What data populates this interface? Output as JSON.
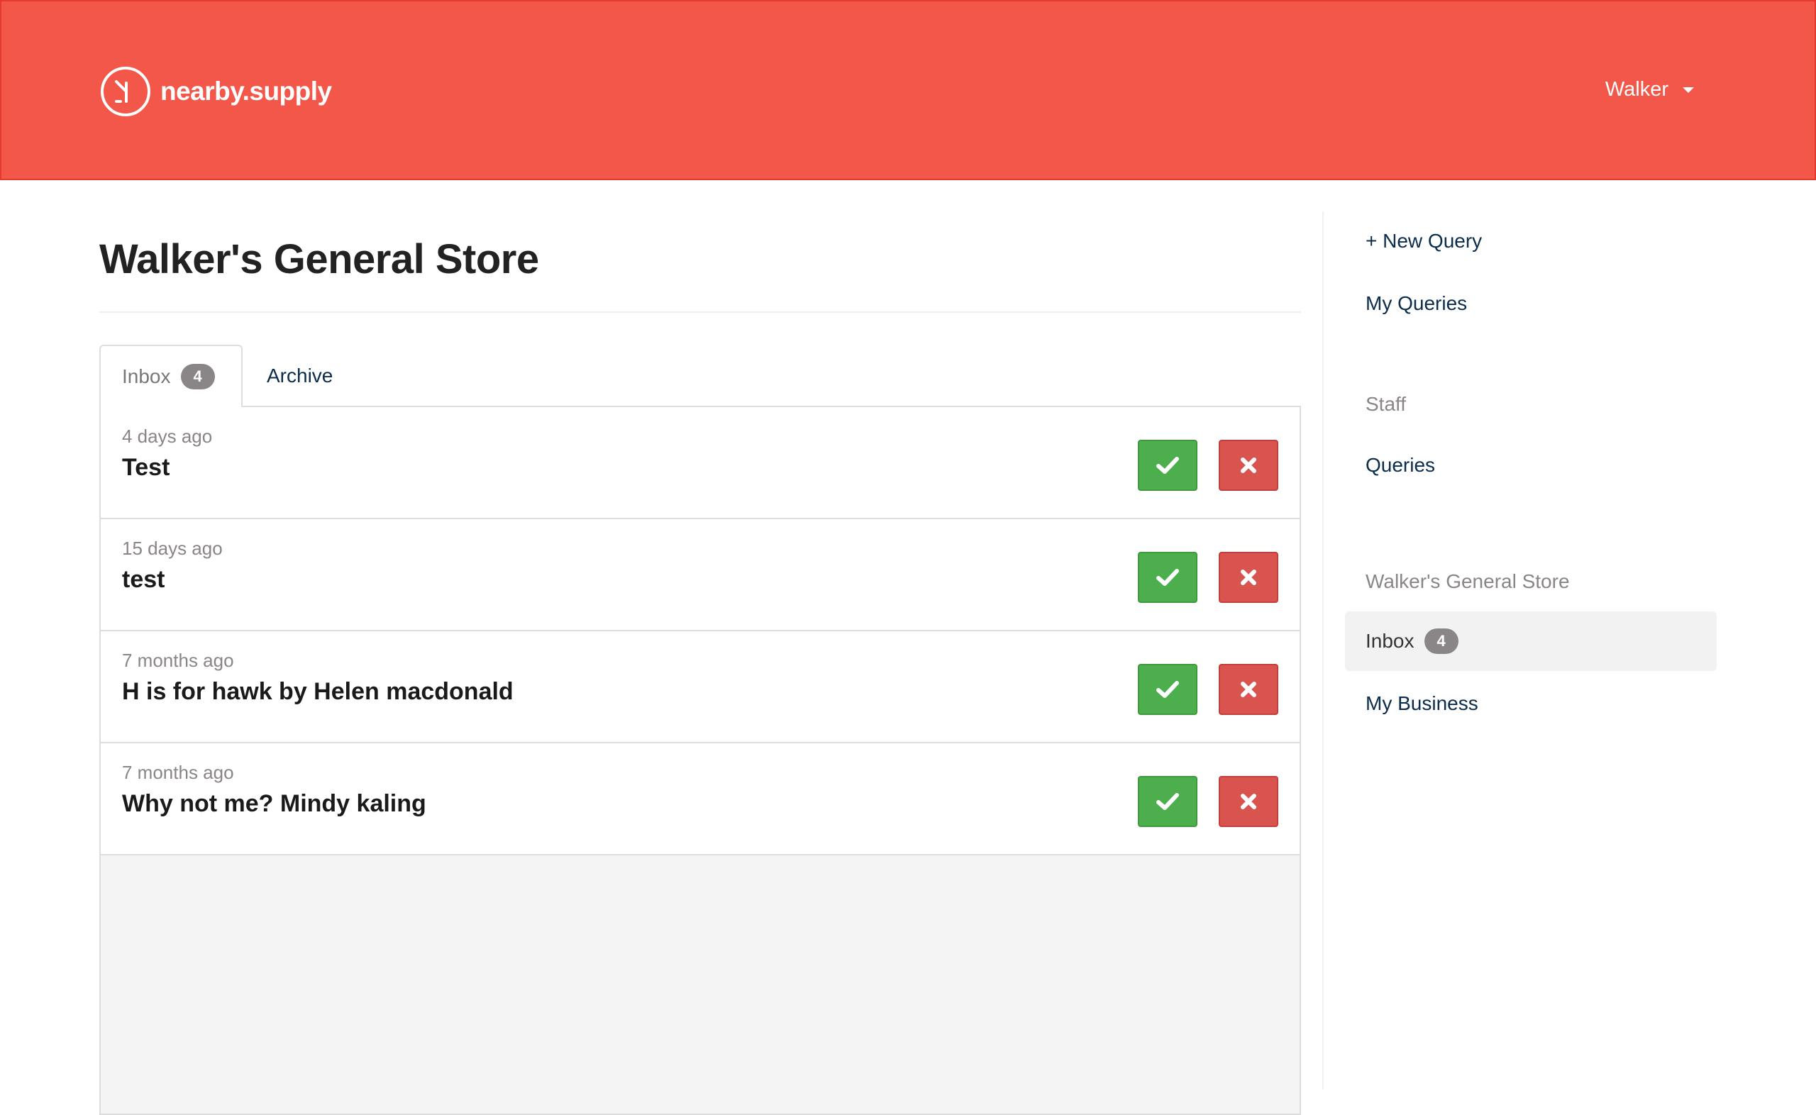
{
  "header": {
    "brand": "nearby.supply",
    "user": "Walker"
  },
  "page": {
    "title": "Walker's General Store"
  },
  "tabs": [
    {
      "label": "Inbox",
      "badge": "4",
      "active": true
    },
    {
      "label": "Archive",
      "active": false
    }
  ],
  "queries": [
    {
      "time": "4 days ago",
      "title": "Test"
    },
    {
      "time": "15 days ago",
      "title": "test"
    },
    {
      "time": "7 months ago",
      "title": "H is for hawk by Helen macdonald"
    },
    {
      "time": "7 months ago",
      "title": "Why not me? Mindy kaling"
    }
  ],
  "sidebar": {
    "new_query": "+ New Query",
    "my_queries": "My Queries",
    "staff_heading": "Staff",
    "staff_queries": "Queries",
    "store_heading": "Walker's General Store",
    "inbox": {
      "label": "Inbox",
      "badge": "4"
    },
    "my_business": "My Business"
  },
  "colors": {
    "header": "#f25749",
    "accept": "#4cae4c",
    "reject": "#d9534f",
    "link": "#0b2c4a",
    "muted": "#8a8586"
  },
  "icons": {
    "accept": "check-icon",
    "reject": "close-icon"
  }
}
